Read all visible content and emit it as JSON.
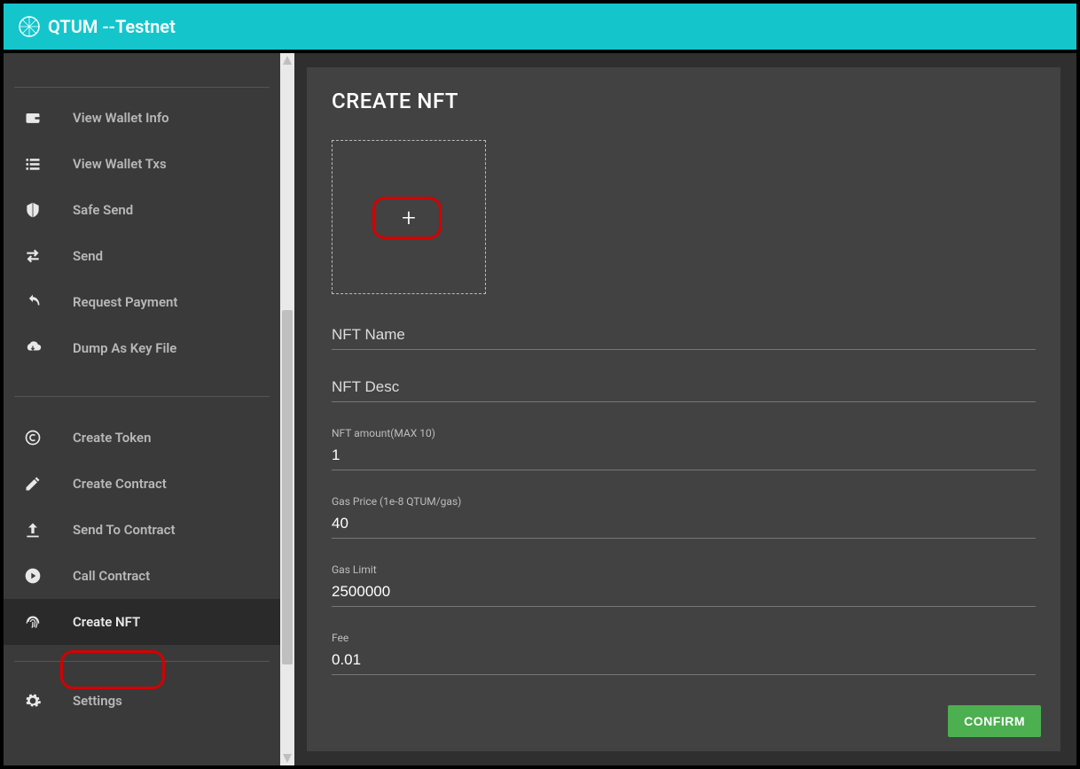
{
  "header": {
    "title": "QTUM --Testnet"
  },
  "sidebar": {
    "group1": [
      {
        "icon": "wallet",
        "label": "View Wallet Info"
      },
      {
        "icon": "list",
        "label": "View Wallet Txs"
      },
      {
        "icon": "shield",
        "label": "Safe Send"
      },
      {
        "icon": "swap",
        "label": "Send"
      },
      {
        "icon": "undo",
        "label": "Request Payment"
      },
      {
        "icon": "cloud-download",
        "label": "Dump As Key File"
      }
    ],
    "group2": [
      {
        "icon": "copyright",
        "label": "Create Token"
      },
      {
        "icon": "pencil",
        "label": "Create Contract"
      },
      {
        "icon": "upload",
        "label": "Send To Contract"
      },
      {
        "icon": "play-circle",
        "label": "Call Contract"
      },
      {
        "icon": "fingerprint",
        "label": "Create NFT",
        "active": true
      }
    ],
    "group3": [
      {
        "icon": "gear",
        "label": "Settings"
      }
    ]
  },
  "form": {
    "title": "CREATE NFT",
    "upload_icon": "+",
    "nft_name": {
      "placeholder": "NFT Name",
      "value": ""
    },
    "nft_desc": {
      "placeholder": "NFT Desc",
      "value": ""
    },
    "nft_amount": {
      "label": "NFT amount(MAX 10)",
      "value": "1"
    },
    "gas_price": {
      "label": "Gas Price (1e-8 QTUM/gas)",
      "value": "40"
    },
    "gas_limit": {
      "label": "Gas Limit",
      "value": "2500000"
    },
    "fee": {
      "label": "Fee",
      "value": "0.01"
    },
    "confirm_label": "CONFIRM"
  },
  "colors": {
    "accent": "#14c6cc",
    "confirm": "#4caf50",
    "annotation": "#d40000"
  }
}
